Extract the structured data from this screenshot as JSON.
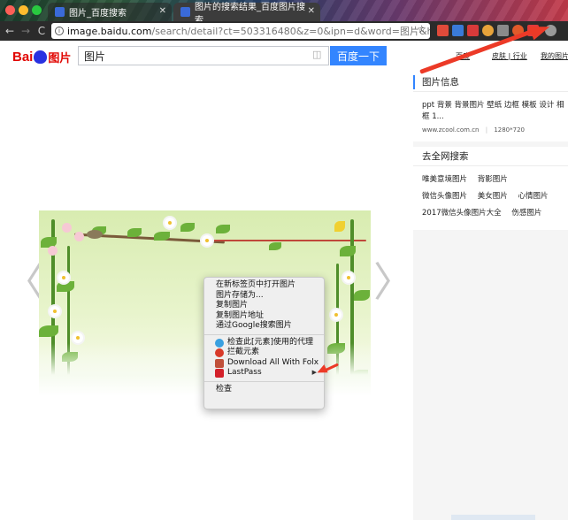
{
  "browser": {
    "tabs": [
      {
        "title": "图片_百度搜索",
        "active": false
      },
      {
        "title": "图片的搜索结果_百度图片搜索",
        "active": true
      }
    ],
    "address": {
      "host": "image.baidu.com",
      "rest": "/search/detail?ct=503316480&z=0&ipn=d&word=图片&hs=0&pn=0&spn=..."
    },
    "nav": {
      "back": "←",
      "forward": "→",
      "reload": "C",
      "star": "☆"
    }
  },
  "header": {
    "logo_text": "Bai",
    "logo_suffix": "图片",
    "search_value": "图片",
    "search_button": "百度一下",
    "links": [
      "百度",
      "皮肤 | 行业",
      "我的图片"
    ]
  },
  "viewer": {
    "prev_arrow": "〈",
    "next_arrow": "〉"
  },
  "context_menu": {
    "items": [
      {
        "label": "在新标签页中打开图片",
        "icon": null
      },
      {
        "label": "图片存储为...",
        "icon": null
      },
      {
        "label": "复制图片",
        "icon": null
      },
      {
        "label": "复制图片地址",
        "icon": null
      },
      {
        "label": "通过Google搜索图片",
        "icon": null
      },
      {
        "label": "检查此[元素]使用的代理",
        "icon": "proxy-icon"
      },
      {
        "label": "拦截元素",
        "icon": "adblock-icon"
      },
      {
        "label": "Download All With Folx",
        "icon": "folx-icon"
      },
      {
        "label": "LastPass",
        "icon": "lastpass-icon",
        "submenu": "▶"
      },
      {
        "label": "检查",
        "icon": null
      }
    ]
  },
  "panel": {
    "info_title": "图片信息",
    "info_text": "ppt 背景 背景图片 壁纸 边框 模板 设计 相框 1...",
    "info_source": "www.zcool.com.cn",
    "info_divider": "|",
    "info_size": "1280*720",
    "web_title": "去全网搜索",
    "web_links": [
      [
        "唯美意境图片",
        "背影图片"
      ],
      [
        "微信头像图片",
        "美女图片",
        "心情图片"
      ],
      [
        "2017微信头像图片大全",
        "伤感图片"
      ]
    ]
  },
  "colors": {
    "accent_blue": "#3385ff",
    "baidu_red": "#e10602",
    "annotation_red": "#ec3a27"
  }
}
